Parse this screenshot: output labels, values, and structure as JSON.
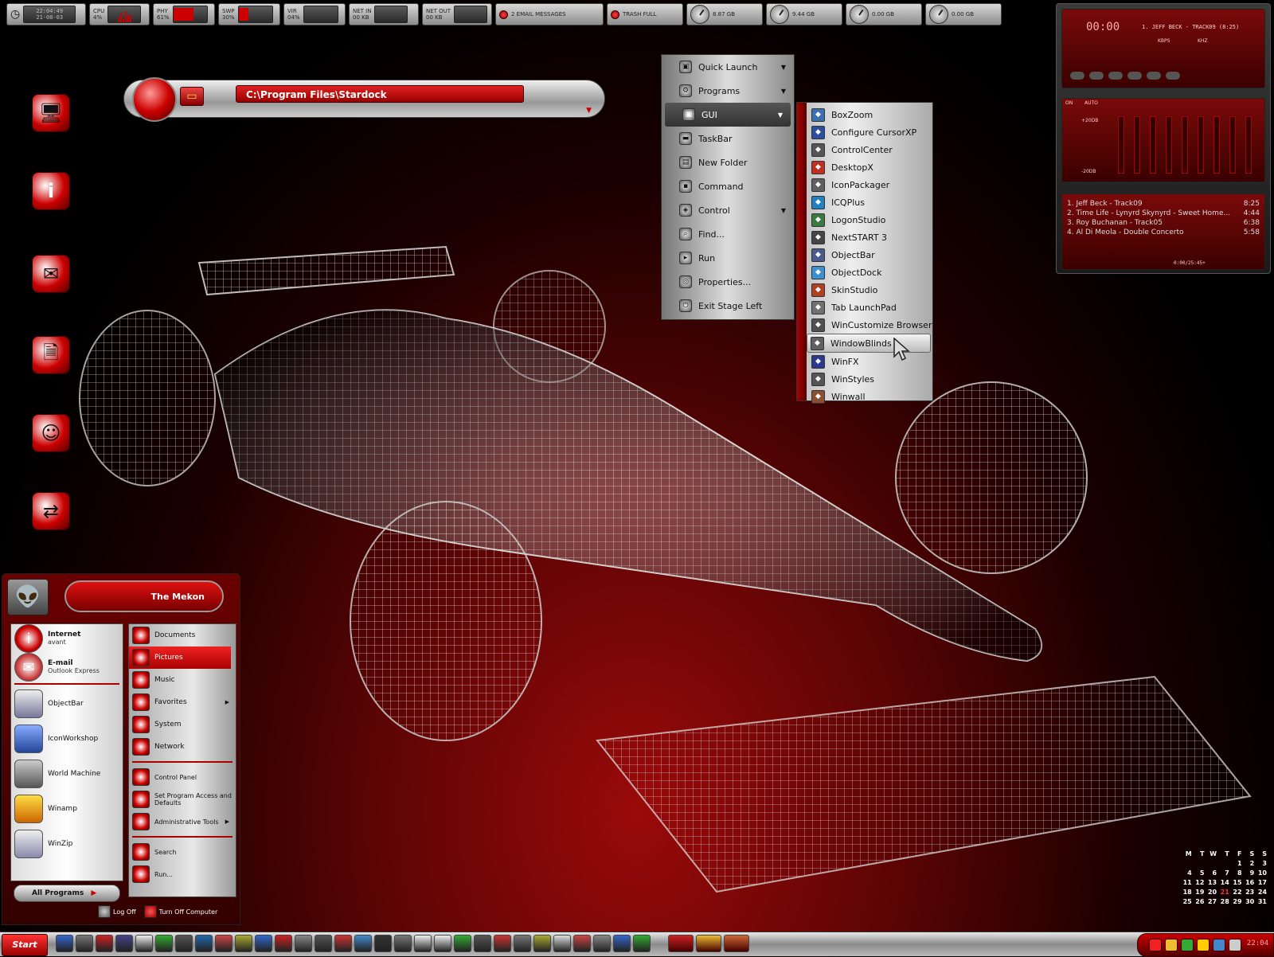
{
  "monitor": {
    "clock_time": "22:04:49",
    "clock_date": "21-08-03",
    "cpu_label": "CPU",
    "cpu_value": "4%",
    "phy_label": "PHY",
    "phy_value": "61%",
    "swp_label": "SWP",
    "swp_value": "30%",
    "vir_label": "VIR",
    "vir_value": "04%",
    "netin_label": "NET IN",
    "netin_value": "00 KB",
    "netout_label": "NET OUT",
    "netout_value": "00 KB",
    "email": "2 EMAIL MESSAGES",
    "trash": "TRASH FULL",
    "drive1": "8.87 GB",
    "drive2": "9.44 GB",
    "drive3": "0.00 GB",
    "drive4": "0.00 GB"
  },
  "winamp": {
    "title": "1. JEFF BECK - TRACK09 (8:25)",
    "time": "00:00",
    "kbps": "KBPS",
    "khz": "KHZ",
    "eq_on": "ON",
    "eq_auto": "AUTO",
    "eq_top": "+20DB",
    "eq_bottom": "-20DB",
    "playlist": [
      {
        "title": "1. Jeff Beck - Track09",
        "time": "8:25"
      },
      {
        "title": "2. Time Life - Lynyrd Skynyrd - Sweet Home...",
        "time": "4:44"
      },
      {
        "title": "3. Roy Buchanan - Track05",
        "time": "6:38"
      },
      {
        "title": "4. Al Di Meola - Double Concerto",
        "time": "5:58"
      }
    ],
    "pl_time": "0:00/25:45+"
  },
  "address": {
    "path": "C:\\Program Files\\Stardock"
  },
  "objectbar_menu": [
    {
      "label": "Quick Launch",
      "icon": "window-icon",
      "arrow": true
    },
    {
      "label": "Programs",
      "icon": "gear-icon",
      "arrow": true
    },
    {
      "label": "GUI",
      "icon": "window-icon",
      "arrow": true,
      "selected": true
    },
    {
      "label": "TaskBar",
      "icon": "taskbar-icon"
    },
    {
      "label": "New Folder",
      "icon": "folder-icon"
    },
    {
      "label": "Command",
      "icon": "command-icon"
    },
    {
      "label": "Control",
      "icon": "control-icon",
      "arrow": true
    },
    {
      "label": "Find...",
      "icon": "search-icon"
    },
    {
      "label": "Run",
      "icon": "run-icon"
    },
    {
      "label": "Properties...",
      "icon": "properties-icon"
    },
    {
      "label": "Exit Stage Left",
      "icon": "exit-icon"
    }
  ],
  "gui_menu": [
    {
      "label": "BoxZoom",
      "color": "#3a6fb0"
    },
    {
      "label": "Configure CursorXP",
      "color": "#2a4fa0"
    },
    {
      "label": "ControlCenter",
      "color": "#555555"
    },
    {
      "label": "DesktopX",
      "color": "#c03020"
    },
    {
      "label": "IconPackager",
      "color": "#606060"
    },
    {
      "label": "ICQPlus",
      "color": "#2080c0"
    },
    {
      "label": "LogonStudio",
      "color": "#3a7a40"
    },
    {
      "label": "NextSTART 3",
      "color": "#444444"
    },
    {
      "label": "ObjectBar",
      "color": "#4a5a8a"
    },
    {
      "label": "ObjectDock",
      "color": "#3a90d0"
    },
    {
      "label": "SkinStudio",
      "color": "#b04020"
    },
    {
      "label": "Tab LaunchPad",
      "color": "#707070"
    },
    {
      "label": "WinCustomize Browser",
      "color": "#505050"
    },
    {
      "label": "WindowBlinds",
      "color": "#606060",
      "hover": true
    },
    {
      "label": "WinFX",
      "color": "#2a3a90"
    },
    {
      "label": "WinStyles",
      "color": "#555555"
    },
    {
      "label": "Winwall",
      "color": "#8a5030"
    }
  ],
  "start_menu": {
    "user": "The Mekon",
    "pinned": [
      {
        "name": "Internet",
        "sub": "avant",
        "icon": "info-icon"
      },
      {
        "name": "E-mail",
        "sub": "Outlook Express",
        "icon": "mail-icon"
      }
    ],
    "recent": [
      {
        "name": "ObjectBar",
        "icon": "objectbar-icon"
      },
      {
        "name": "IconWorkshop",
        "icon": "iconworkshop-icon"
      },
      {
        "name": "World Machine",
        "icon": "world-machine-icon"
      },
      {
        "name": "Winamp",
        "icon": "winamp-icon"
      },
      {
        "name": "WinZip",
        "icon": "winzip-icon"
      }
    ],
    "all_programs": "All Programs",
    "places": [
      {
        "label": "Documents"
      },
      {
        "label": "Pictures",
        "selected": true
      },
      {
        "label": "Music"
      },
      {
        "label": "Favorites",
        "arrow": true
      },
      {
        "label": "System"
      },
      {
        "label": "Network"
      }
    ],
    "tools": [
      {
        "label": "Control Panel"
      },
      {
        "label": "Set Program Access and Defaults"
      },
      {
        "label": "Administrative Tools",
        "arrow": true
      }
    ],
    "actions": [
      {
        "label": "Search"
      },
      {
        "label": "Run..."
      }
    ],
    "log_off": "Log Off",
    "turn_off": "Turn Off Computer"
  },
  "taskbar": {
    "start_label": "Start",
    "clock": "22:04"
  },
  "calendar": {
    "headers": [
      "M",
      "T",
      "W",
      "T",
      "F",
      "S",
      "S"
    ],
    "weeks": [
      [
        "",
        "",
        "",
        "",
        "1",
        "2",
        "3"
      ],
      [
        "4",
        "5",
        "6",
        "7",
        "8",
        "9",
        "10"
      ],
      [
        "11",
        "12",
        "13",
        "14",
        "15",
        "16",
        "17"
      ],
      [
        "18",
        "19",
        "20",
        "21",
        "22",
        "23",
        "24"
      ],
      [
        "25",
        "26",
        "27",
        "28",
        "29",
        "30",
        "31"
      ]
    ],
    "today": "21"
  }
}
